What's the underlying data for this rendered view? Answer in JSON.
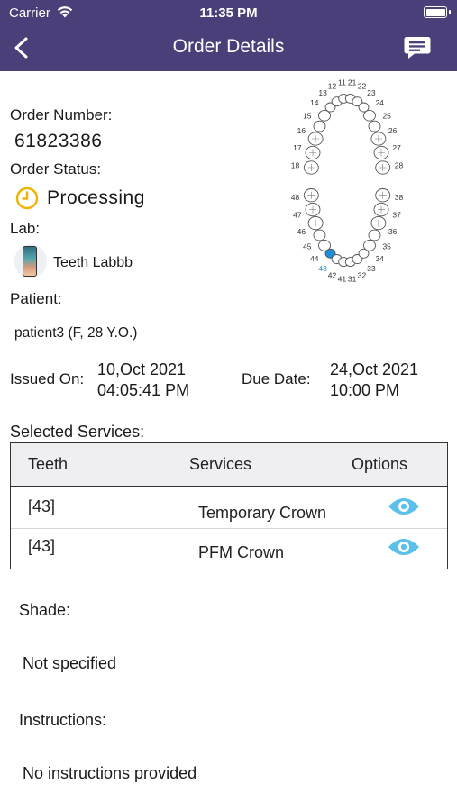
{
  "status_bar": {
    "carrier": "Carrier",
    "time": "11:35 PM"
  },
  "nav": {
    "title": "Order Details"
  },
  "order": {
    "number_label": "Order Number:",
    "number": "61823386",
    "status_label": "Order Status:",
    "status": "Processing",
    "lab_label": "Lab:",
    "lab_name": "Teeth Labbb",
    "patient_label": "Patient:",
    "patient": "patient3 (F, 28 Y.O.)",
    "issued_label": "Issued On:",
    "issued_date": "10,Oct 2021",
    "issued_time": "04:05:41 PM",
    "due_label": "Due Date:",
    "due_date": "24,Oct 2021",
    "due_time": "10:00 PM"
  },
  "tooth_chart": {
    "upper_numbers": [
      "18",
      "17",
      "16",
      "15",
      "14",
      "13",
      "12",
      "11",
      "21",
      "22",
      "23",
      "24",
      "25",
      "26",
      "27",
      "28"
    ],
    "lower_numbers": [
      "48",
      "47",
      "46",
      "45",
      "44",
      "43",
      "42",
      "41",
      "31",
      "32",
      "33",
      "34",
      "35",
      "36",
      "37",
      "38"
    ],
    "selected": [
      "43"
    ],
    "selected_color": "#1e8fd6"
  },
  "services": {
    "section_label": "Selected Services:",
    "columns": [
      "Teeth",
      "Services",
      "Options"
    ],
    "rows": [
      {
        "teeth": "[43]",
        "service": "Temporary Crown",
        "option_icon": "eye-icon"
      },
      {
        "teeth": "[43]",
        "service": "PFM Crown",
        "option_icon": "eye-icon"
      }
    ]
  },
  "shade": {
    "label": "Shade:",
    "value": "Not specified"
  },
  "instructions": {
    "label": "Instructions:",
    "value": "No instructions provided"
  },
  "colors": {
    "nav_bg": "#4a3f78",
    "status_icon": "#f0b400",
    "eye": "#5bc0eb"
  }
}
